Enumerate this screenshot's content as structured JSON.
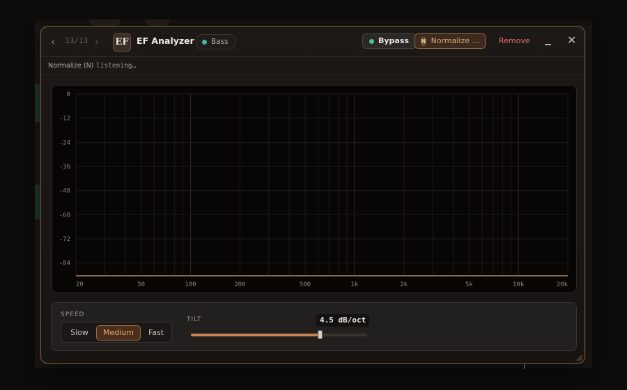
{
  "window": {
    "nav": {
      "counter": "13/13",
      "prev_icon": "chevron-left-icon",
      "next_icon": "chevron-right-icon"
    },
    "logo_text": "EF",
    "title": "EF Analyzer",
    "track": {
      "label": "Bass",
      "color": "#3fb9a0"
    },
    "bypass": {
      "label": "Bypass",
      "color": "#41c79b"
    },
    "normalize": {
      "chip": "N",
      "label": "Normalize ..."
    },
    "remove_label": "Remove",
    "minimize_icon": "minimize-icon",
    "close_icon": "close-icon"
  },
  "status": {
    "key": "Normalize (N)",
    "value": "listening…"
  },
  "analyzer": {
    "y_ticks": [
      "0",
      "-12",
      "-24",
      "-36",
      "-48",
      "-60",
      "-72",
      "-84"
    ],
    "y_values": [
      0,
      -12,
      -24,
      -36,
      -48,
      -60,
      -72,
      -84
    ],
    "x_ticks": [
      "20",
      "50",
      "100",
      "200",
      "500",
      "1k",
      "2k",
      "5k",
      "10k",
      "20k"
    ],
    "x_values": [
      20,
      50,
      100,
      200,
      500,
      1000,
      2000,
      5000,
      10000,
      20000
    ],
    "x_range": [
      20,
      20000
    ],
    "y_range": [
      0,
      -90
    ],
    "x_scale": "log"
  },
  "controls": {
    "speed_label": "SPEED",
    "speed_options": [
      "Slow",
      "Medium",
      "Fast"
    ],
    "speed_selected": "Medium",
    "tilt_label": "TILT",
    "tilt_value": "4.5 dB/oct",
    "tilt_fraction": 0.73
  },
  "colors": {
    "accent": "#c98451",
    "danger": "#e0726d",
    "border": "#7a5636"
  }
}
